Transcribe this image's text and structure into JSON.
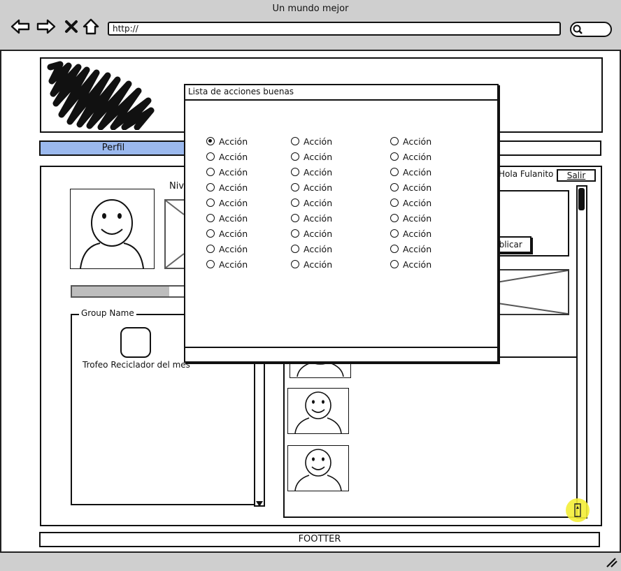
{
  "window": {
    "title": "Un mundo mejor"
  },
  "toolbar": {
    "back_icon": "arrow-left-icon",
    "forward_icon": "arrow-right-icon",
    "stop_icon": "close-icon",
    "home_icon": "home-icon",
    "url": "http://",
    "search_icon": "search-icon"
  },
  "menu": {
    "active_tab": "Perfil",
    "active_color": "#9bb9ee"
  },
  "profile": {
    "level_label": "Nive",
    "progress": 0.85
  },
  "group": {
    "legend": "Group Name",
    "trophy_label": "Trofeo Reciclador del mes"
  },
  "account": {
    "greeting": "Hola Fulanito",
    "logout_label": "Salir"
  },
  "post": {
    "publish_label": "ublicar"
  },
  "footer": {
    "label": "FOOTTER"
  },
  "modal": {
    "title": "Lista de acciones buenas",
    "columns": [
      {
        "items": [
          "Acción",
          "Acción",
          "Acción",
          "Acción",
          "Acción",
          "Acción",
          "Acción",
          "Acción",
          "Acción"
        ],
        "selected_index": 0
      },
      {
        "items": [
          "Acción",
          "Acción",
          "Acción",
          "Acción",
          "Acción",
          "Acción",
          "Acción",
          "Acción",
          "Acción"
        ],
        "selected_index": -1
      },
      {
        "items": [
          "Acción",
          "Acción",
          "Acción",
          "Acción",
          "Acción",
          "Acción",
          "Acción",
          "Acción",
          "Acción"
        ],
        "selected_index": -1
      }
    ]
  },
  "colors": {
    "chrome": "#cfcfcf",
    "tab_active": "#9bb9ee",
    "cursor_highlight": "#f5ef38"
  }
}
